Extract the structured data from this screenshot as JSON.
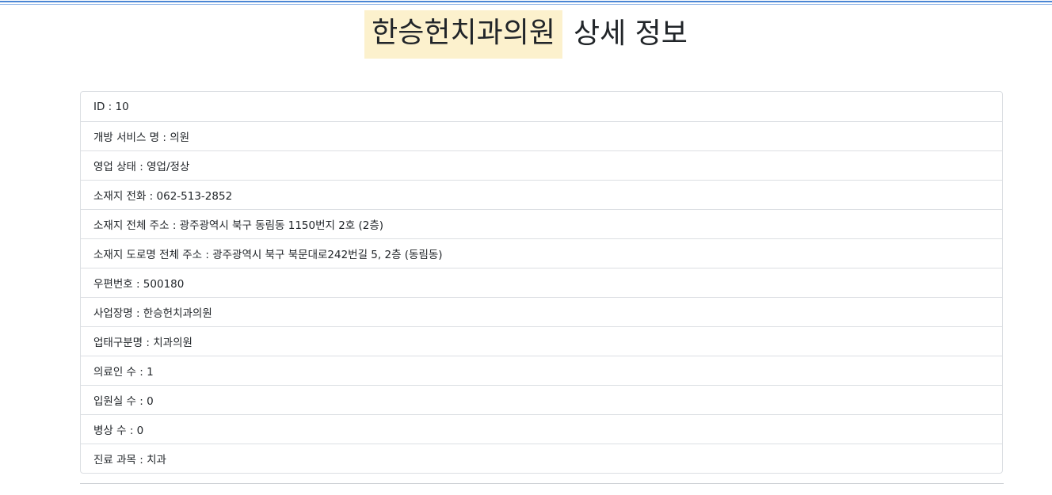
{
  "header": {
    "title_highlight": "한승헌치과의원",
    "title_suffix": "상세 정보"
  },
  "details": [
    {
      "text": "ID : 10"
    },
    {
      "text": "개방 서비스 명 : 의원"
    },
    {
      "text": "영업 상태 : 영업/정상"
    },
    {
      "text": "소재지 전화 : 062-513-2852"
    },
    {
      "text": "소재지 전체 주소 : 광주광역시 북구 동림동 1150번지 2호 (2층)"
    },
    {
      "text": "소재지 도로명 전체 주소 : 광주광역시 북구 북문대로242번길 5, 2층 (동림동)"
    },
    {
      "text": "우편번호 : 500180"
    },
    {
      "text": "사업장명 : 한승헌치과의원"
    },
    {
      "text": "업태구분명 : 치과의원"
    },
    {
      "text": "의료인 수 : 1"
    },
    {
      "text": "입원실 수 : 0"
    },
    {
      "text": "병상 수 : 0"
    },
    {
      "text": "진료 과목 : 치과"
    }
  ],
  "colors": {
    "highlight": "#fcf1cd",
    "border": "#dcdfe3",
    "top_rule": "#4a86d4"
  }
}
